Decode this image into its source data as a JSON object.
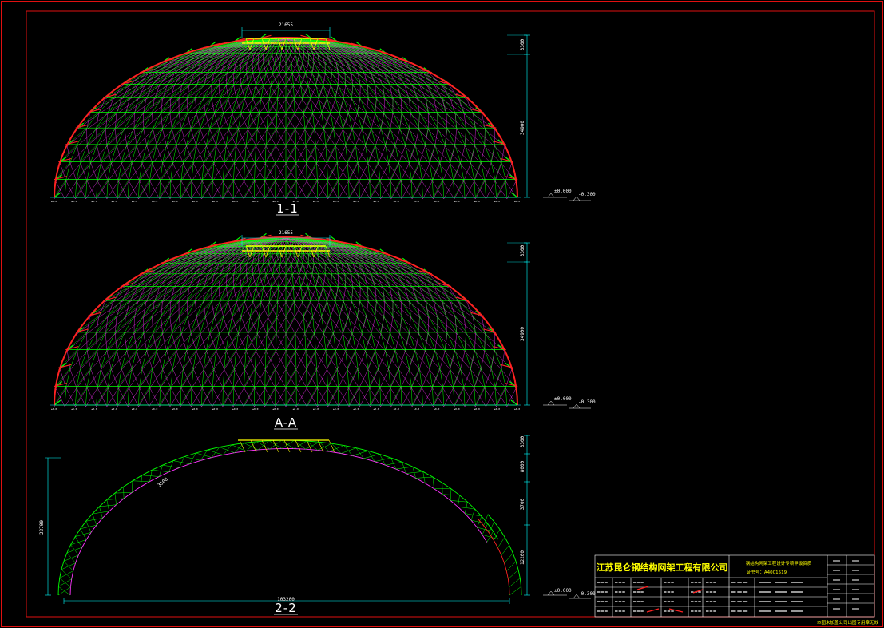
{
  "sections": [
    {
      "label": "1-1",
      "top_dim": "21655",
      "height_dims": [
        "3300",
        "34900"
      ],
      "levels": [
        "±0.000",
        "-0.300"
      ]
    },
    {
      "label": "A-A",
      "top_dim": "21655",
      "height_dims": [
        "3300",
        "34900"
      ],
      "levels": [
        "±0.000",
        "-0.300"
      ]
    },
    {
      "label": "2-2",
      "span_dim": "103200",
      "left_height_dim": "22700",
      "height_dims": [
        "3300",
        "8000",
        "3700",
        "12200"
      ],
      "levels": [
        "±0.000",
        "-0.300"
      ],
      "arc_dim": "3500"
    }
  ],
  "title_block": {
    "company": "江苏昆仑钢结构网架工程有限公司",
    "qualification": "钢结构网架工程设计专项甲级资质",
    "cert_no": "证书号：A4001519"
  },
  "footer_note": "本图未加盖公司出图专用章无效",
  "colors": {
    "frame": "#e01010",
    "top_chord": "#ff2222",
    "web": "#00ff00",
    "bottom_chord": "#ff33ff",
    "crown": "#ffff00",
    "dim": "#00ffff"
  }
}
